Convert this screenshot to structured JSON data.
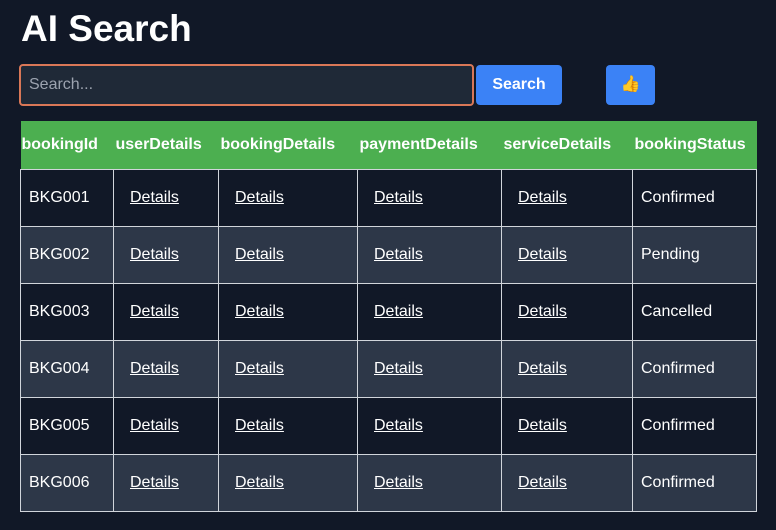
{
  "header": {
    "title": "AI Search"
  },
  "search": {
    "placeholder": "Search...",
    "value": "",
    "button_label": "Search"
  },
  "thumb_button": {
    "icon": "thumbs-up-icon",
    "glyph": "👍"
  },
  "table": {
    "header_color": "#4caf50",
    "columns": [
      "bookingId",
      "userDetails",
      "bookingDetails",
      "paymentDetails",
      "serviceDetails",
      "bookingStatus"
    ],
    "rows": [
      {
        "bookingId": "BKG001",
        "userDetails": "Details",
        "bookingDetails": "Details",
        "paymentDetails": "Details",
        "serviceDetails": "Details",
        "bookingStatus": "Confirmed"
      },
      {
        "bookingId": "BKG002",
        "userDetails": "Details",
        "bookingDetails": "Details",
        "paymentDetails": "Details",
        "serviceDetails": "Details",
        "bookingStatus": "Pending"
      },
      {
        "bookingId": "BKG003",
        "userDetails": "Details",
        "bookingDetails": "Details",
        "paymentDetails": "Details",
        "serviceDetails": "Details",
        "bookingStatus": "Cancelled"
      },
      {
        "bookingId": "BKG004",
        "userDetails": "Details",
        "bookingDetails": "Details",
        "paymentDetails": "Details",
        "serviceDetails": "Details",
        "bookingStatus": "Confirmed"
      },
      {
        "bookingId": "BKG005",
        "userDetails": "Details",
        "bookingDetails": "Details",
        "paymentDetails": "Details",
        "serviceDetails": "Details",
        "bookingStatus": "Confirmed"
      },
      {
        "bookingId": "BKG006",
        "userDetails": "Details",
        "bookingDetails": "Details",
        "paymentDetails": "Details",
        "serviceDetails": "Details",
        "bookingStatus": "Confirmed"
      }
    ]
  }
}
